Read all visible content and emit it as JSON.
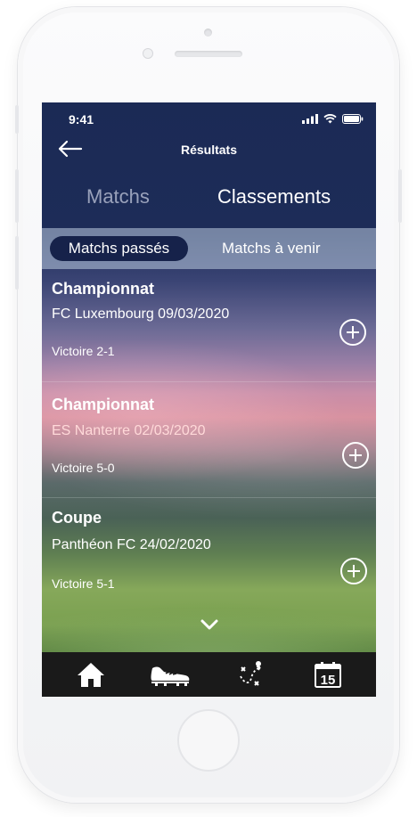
{
  "status_bar": {
    "time": "9:41"
  },
  "header": {
    "title": "Résultats"
  },
  "main_tabs": [
    {
      "label": "Matchs",
      "active": false
    },
    {
      "label": "Classements",
      "active": true
    }
  ],
  "segments": [
    {
      "label": "Matchs passés",
      "active": true
    },
    {
      "label": "Matchs à venir",
      "active": false
    }
  ],
  "matches": [
    {
      "competition": "Championnat",
      "opponent": "FC Luxembourg 09/03/2020",
      "result": "Victoire 2-1",
      "opponent_color": "#ffffff"
    },
    {
      "competition": "Championnat",
      "opponent": "ES Nanterre 02/03/2020",
      "result": "Victoire 5-0",
      "opponent_color": "#ffd9d9"
    },
    {
      "competition": "Coupe",
      "opponent": "Panthéon FC 24/02/2020",
      "result": "Victoire 5-1",
      "opponent_color": "#ffffff"
    }
  ],
  "bottom_tabs": [
    {
      "icon": "home-icon"
    },
    {
      "icon": "football-boot-icon"
    },
    {
      "icon": "tactics-icon"
    },
    {
      "icon": "calendar-icon",
      "day": "15"
    }
  ],
  "colors": {
    "accent_pill": "#16224a",
    "tab_bar": "#1a1a1a"
  }
}
